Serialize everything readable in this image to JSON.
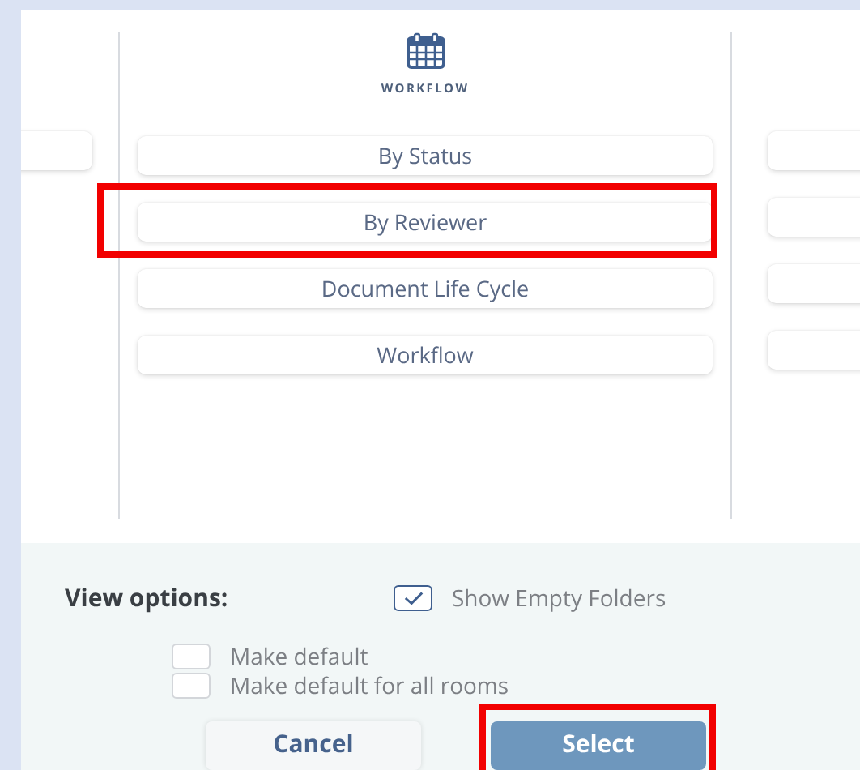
{
  "left_column": {
    "buttons": [
      {
        "kind": "blank"
      }
    ]
  },
  "workflow_column": {
    "heading": "WORKFLOW",
    "options": [
      {
        "label": "By Status",
        "highlighted": false
      },
      {
        "label": "By Reviewer",
        "highlighted": true
      },
      {
        "label": "Document Life Cycle",
        "highlighted": false
      },
      {
        "label": "Workflow",
        "highlighted": false
      }
    ]
  },
  "right_column": {
    "buttons": [
      {
        "kind": "blank"
      },
      {
        "kind": "blank"
      },
      {
        "kind": "blank"
      },
      {
        "kind": "blank"
      }
    ]
  },
  "view_options": {
    "label": "View options:",
    "show_empty_folders": {
      "label": "Show Empty Folders",
      "checked": true
    },
    "defaults": [
      {
        "label": "Make default",
        "checked": false
      },
      {
        "label": "Make default for all rooms",
        "checked": false
      }
    ]
  },
  "buttons": [
    {
      "label": "Cancel",
      "kind": "secondary",
      "highlighted": false
    },
    {
      "label": "Select",
      "kind": "primary",
      "highlighted": true
    }
  ]
}
